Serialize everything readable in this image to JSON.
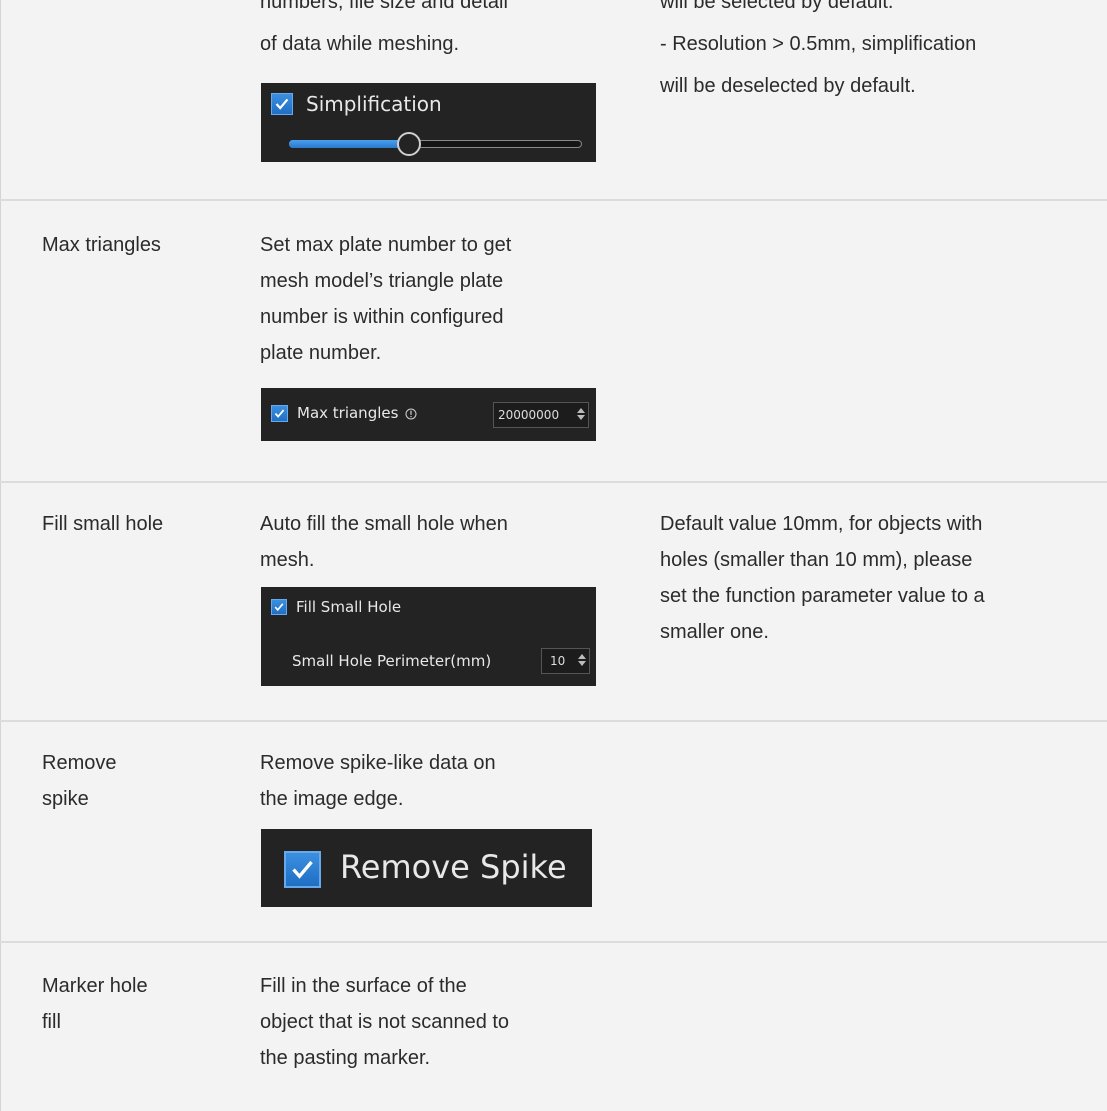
{
  "rows": [
    {
      "desc_lines": [
        "numbers, file size and detail",
        "of data while meshing."
      ],
      "note_lines": [
        "will be selected by default.",
        "- Resolution > 0.5mm, simplification",
        "will be deselected by default."
      ],
      "panel": {
        "checkbox_label": "Simplification",
        "checked": true,
        "slider_level": 0.41
      }
    },
    {
      "name_lines": [
        "Max triangles"
      ],
      "desc_lines": [
        "Set max plate number to get",
        "mesh model’s triangle plate",
        "number is within configured",
        "plate number."
      ],
      "panel": {
        "checkbox_label": "Max triangles",
        "info_icon": "info-icon",
        "spin_value": "20000000",
        "checked": true
      }
    },
    {
      "name_lines": [
        "Fill small hole"
      ],
      "desc_lines": [
        "Auto fill the small hole when",
        "mesh."
      ],
      "note_lines": [
        "Default value 10mm, for objects with",
        "holes (smaller than 10 mm), please",
        "set the function parameter value to a",
        "smaller one."
      ],
      "panel": {
        "checkbox_label": "Fill Small Hole",
        "param_label": "Small Hole Perimeter(mm)",
        "spin_value": "10",
        "checked": true
      }
    },
    {
      "name_lines": [
        "Remove",
        "spike"
      ],
      "desc_lines": [
        "Remove spike-like data on",
        "the image edge."
      ],
      "panel": {
        "checkbox_label": "Remove Spike",
        "checked": true
      }
    },
    {
      "name_lines": [
        "Marker hole",
        "fill"
      ],
      "desc_lines": [
        "Fill in the surface of the",
        "object that is not scanned to",
        "the pasting marker."
      ]
    }
  ],
  "colors": {
    "accent": "#2a7fd6",
    "panel_bg": "#232323",
    "page_bg": "#f3f3f3"
  }
}
